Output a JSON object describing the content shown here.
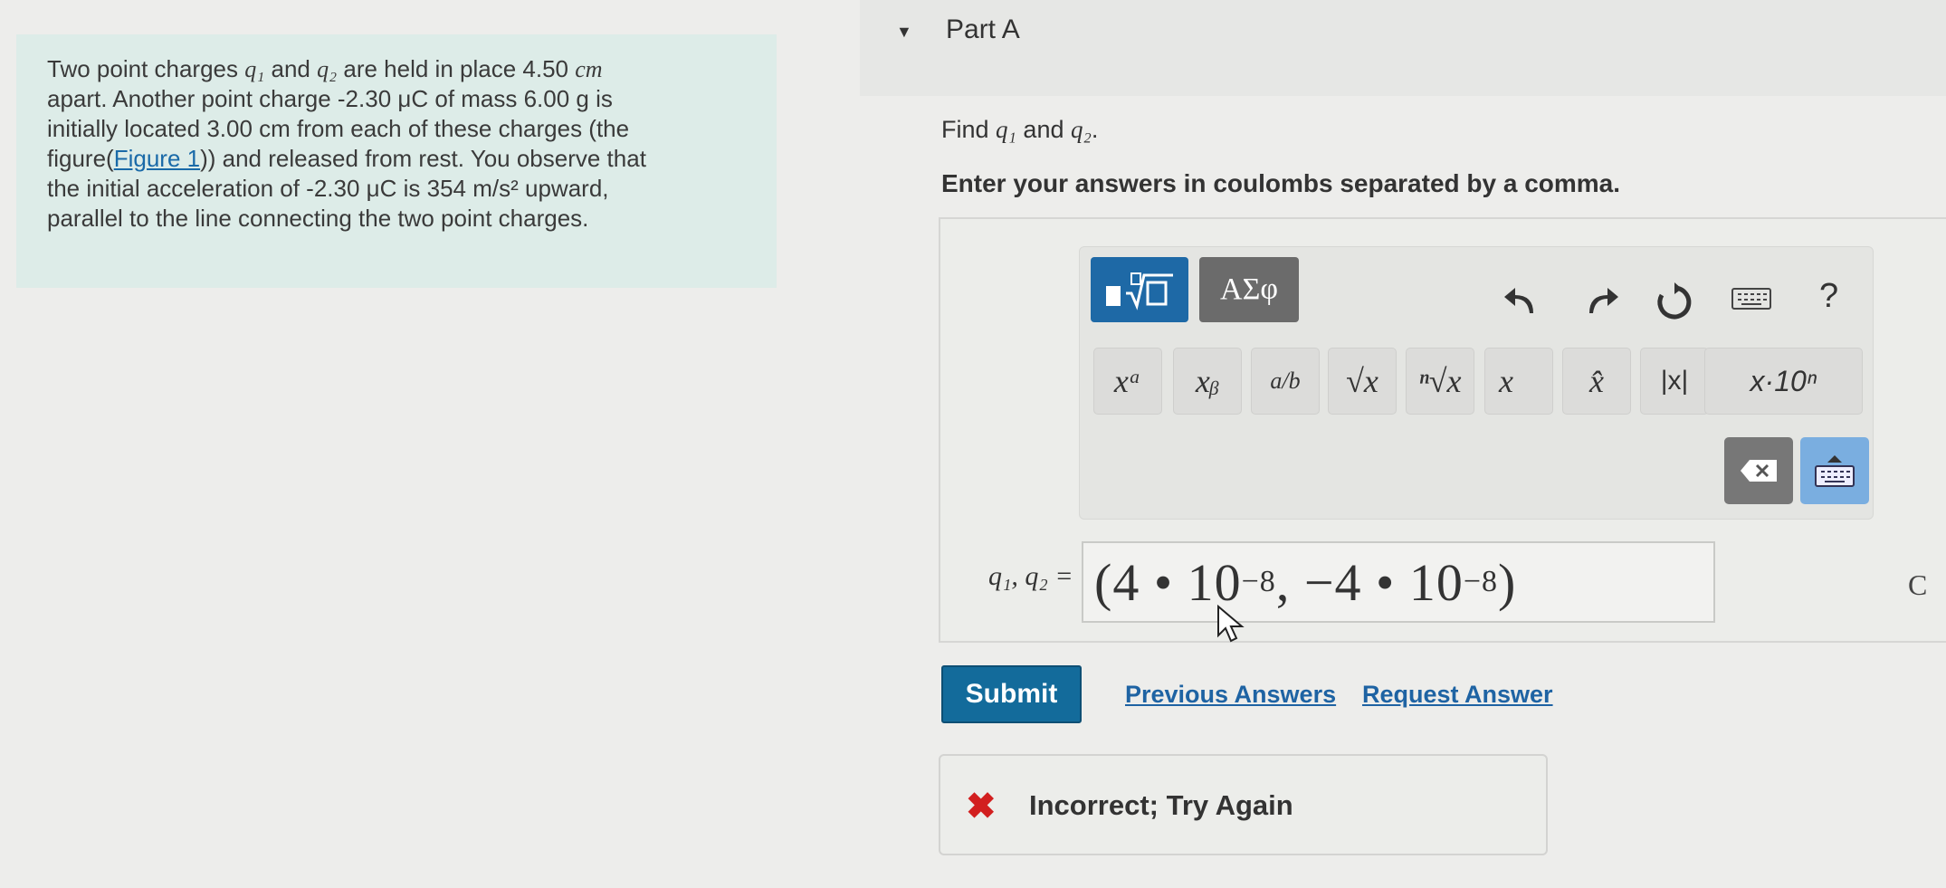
{
  "problem": {
    "line1_a": "Two point charges ",
    "q1": "q₁",
    "line1_b": " and ",
    "q2": "q₂",
    "line1_c": " are held in place 4.50 ",
    "cm": "cm",
    "line2": "apart. Another point charge -2.30 μC of mass 6.00 g is",
    "line3": "initially located 3.00 cm from each of these charges (the",
    "line4_a": "figure(",
    "figure_link": "Figure 1",
    "line4_b": ")) and released from rest. You observe that",
    "line5": "the initial acceleration of -2.30 μC is 354 m/s² upward,",
    "line6": "parallel to the line connecting the two point charges."
  },
  "part": {
    "caret": "▼",
    "title": "Part A"
  },
  "question": {
    "find_a": "Find ",
    "q1": "q₁",
    "find_b": " and ",
    "q2": "q₂",
    "find_c": ".",
    "instructions": "Enter your answers in coulombs separated by a comma."
  },
  "toolbar": {
    "greek_label": "ΑΣφ",
    "help": "?",
    "keys": {
      "superscript": "xᵃ",
      "subscript": "xᵦ",
      "fraction": "a/b",
      "sqrt": "√x",
      "nthroot": "ⁿ√x",
      "vector": "x⃗",
      "unit_vector": "x̂",
      "abs": "|x|",
      "sci": "x·10ⁿ"
    }
  },
  "answer": {
    "label": "q₁, q₂ =",
    "value_a": "(4 • 10",
    "exp_a": "−8",
    "value_b": ", −4 • 10",
    "exp_b": "−8",
    "value_c": ")",
    "units": "C"
  },
  "actions": {
    "submit": "Submit",
    "previous_answers": "Previous Answers",
    "request_answer": "Request Answer"
  },
  "feedback": {
    "icon": "✖",
    "text": "Incorrect; Try Again"
  }
}
